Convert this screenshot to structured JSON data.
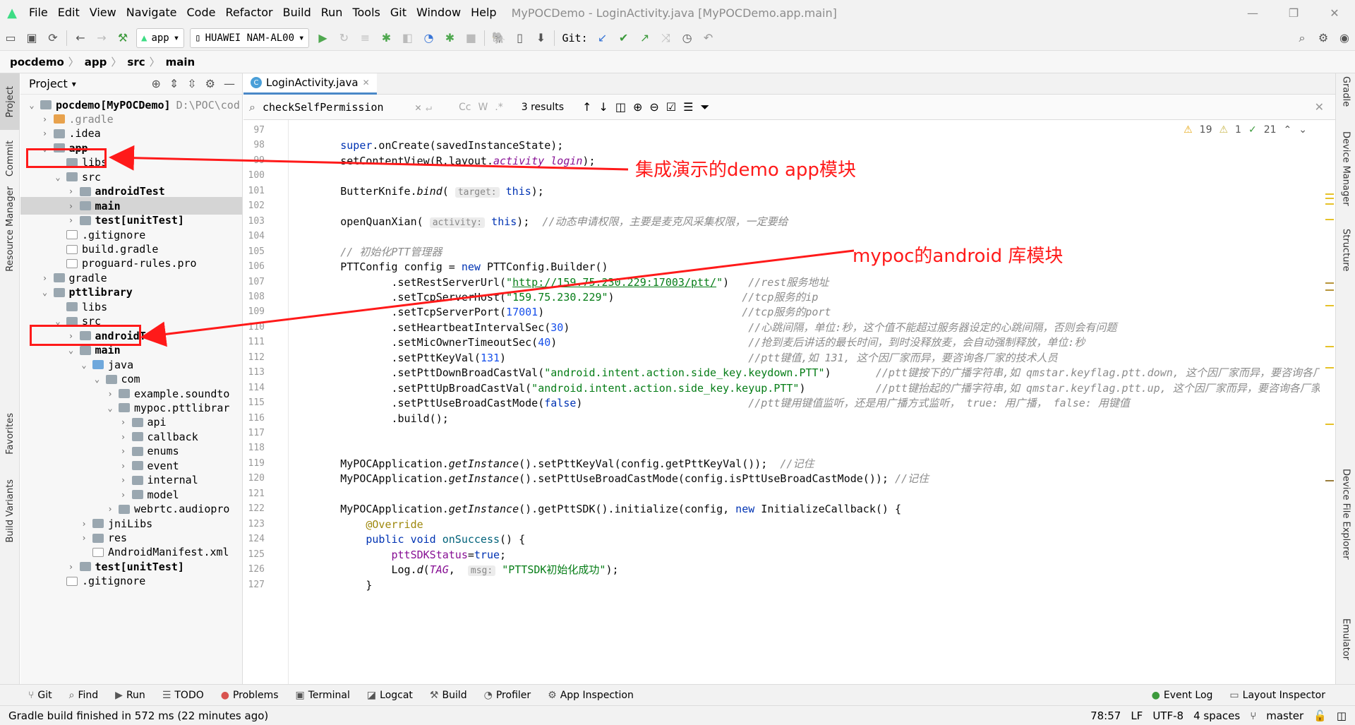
{
  "menubar": {
    "items": [
      "File",
      "Edit",
      "View",
      "Navigate",
      "Code",
      "Refactor",
      "Build",
      "Run",
      "Tools",
      "Git",
      "Window",
      "Help"
    ],
    "window_title": "MyPOCDemo - LoginActivity.java [MyPOCDemo.app.main]"
  },
  "toolbar": {
    "run_config": "app",
    "device": "HUAWEI NAM-AL00",
    "git_label": "Git:"
  },
  "breadcrumb": [
    "pocdemo",
    "app",
    "src",
    "main"
  ],
  "left_tabs": [
    "Project",
    "Commit",
    "Resource Manager",
    "Favorites",
    "Build Variants"
  ],
  "right_tabs": [
    "Gradle",
    "Device Manager",
    "Structure",
    "Device File Explorer",
    "Emulator"
  ],
  "project": {
    "title": "Project",
    "tree": [
      {
        "label": "pocdemo",
        "extra": " [MyPOCDemo]",
        "path": "D:\\POC\\cod",
        "indent": 0,
        "arrow": "down",
        "icon": "f-folder",
        "bold": true
      },
      {
        "label": ".gradle",
        "indent": 1,
        "arrow": "right",
        "icon": "f-orange",
        "ignored": true
      },
      {
        "label": ".idea",
        "indent": 1,
        "arrow": "right",
        "icon": "f-folder"
      },
      {
        "label": "app",
        "indent": 1,
        "arrow": "down",
        "icon": "f-folder",
        "bold": true
      },
      {
        "label": "libs",
        "indent": 2,
        "arrow": "",
        "icon": "f-folder"
      },
      {
        "label": "src",
        "indent": 2,
        "arrow": "down",
        "icon": "f-folder"
      },
      {
        "label": "androidTest",
        "indent": 3,
        "arrow": "right",
        "icon": "f-folder",
        "bold": true
      },
      {
        "label": "main",
        "indent": 3,
        "arrow": "right",
        "icon": "f-folder",
        "bold": true,
        "selected": true
      },
      {
        "label": "test",
        "extra": " [unitTest]",
        "indent": 3,
        "arrow": "right",
        "icon": "f-folder",
        "bold": true
      },
      {
        "label": ".gitignore",
        "indent": 2,
        "arrow": "",
        "icon": "f-file"
      },
      {
        "label": "build.gradle",
        "indent": 2,
        "arrow": "",
        "icon": "f-file"
      },
      {
        "label": "proguard-rules.pro",
        "indent": 2,
        "arrow": "",
        "icon": "f-file"
      },
      {
        "label": "gradle",
        "indent": 1,
        "arrow": "right",
        "icon": "f-folder"
      },
      {
        "label": "pttlibrary",
        "indent": 1,
        "arrow": "down",
        "icon": "f-folder",
        "bold": true
      },
      {
        "label": "libs",
        "indent": 2,
        "arrow": "",
        "icon": "f-folder"
      },
      {
        "label": "src",
        "indent": 2,
        "arrow": "down",
        "icon": "f-folder"
      },
      {
        "label": "androidTest",
        "indent": 3,
        "arrow": "right",
        "icon": "f-folder",
        "bold": true
      },
      {
        "label": "main",
        "indent": 3,
        "arrow": "down",
        "icon": "f-folder",
        "bold": true
      },
      {
        "label": "java",
        "indent": 4,
        "arrow": "down",
        "icon": "f-blue"
      },
      {
        "label": "com",
        "indent": 5,
        "arrow": "down",
        "icon": "f-folder"
      },
      {
        "label": "example.soundto",
        "indent": 6,
        "arrow": "right",
        "icon": "f-folder"
      },
      {
        "label": "mypoc.pttlibrar",
        "indent": 6,
        "arrow": "down",
        "icon": "f-folder"
      },
      {
        "label": "api",
        "indent": 7,
        "arrow": "right",
        "icon": "f-folder"
      },
      {
        "label": "callback",
        "indent": 7,
        "arrow": "right",
        "icon": "f-folder"
      },
      {
        "label": "enums",
        "indent": 7,
        "arrow": "right",
        "icon": "f-folder"
      },
      {
        "label": "event",
        "indent": 7,
        "arrow": "right",
        "icon": "f-folder"
      },
      {
        "label": "internal",
        "indent": 7,
        "arrow": "right",
        "icon": "f-folder"
      },
      {
        "label": "model",
        "indent": 7,
        "arrow": "right",
        "icon": "f-folder"
      },
      {
        "label": "webrtc.audiopro",
        "indent": 6,
        "arrow": "right",
        "icon": "f-folder"
      },
      {
        "label": "jniLibs",
        "indent": 4,
        "arrow": "right",
        "icon": "f-folder"
      },
      {
        "label": "res",
        "indent": 4,
        "arrow": "right",
        "icon": "f-folder"
      },
      {
        "label": "AndroidManifest.xml",
        "indent": 4,
        "arrow": "",
        "icon": "f-file"
      },
      {
        "label": "test",
        "extra": " [unitTest]",
        "indent": 3,
        "arrow": "right",
        "icon": "f-folder",
        "bold": true
      },
      {
        "label": ".gitignore",
        "indent": 2,
        "arrow": "",
        "icon": "f-file"
      }
    ]
  },
  "editor": {
    "tab": "LoginActivity.java",
    "search_query": "checkSelfPermission",
    "search_results": "3 results",
    "inspections": {
      "warnings": "19",
      "weak": "1",
      "ok": "21"
    }
  },
  "code": [
    {
      "n": "97",
      "html": ""
    },
    {
      "n": "98",
      "html": "        <span class='kw'>super</span>.onCreate(savedInstanceState);"
    },
    {
      "n": "99",
      "html": "        setContentView(R.layout.<span class='stat'>activity_login</span>);"
    },
    {
      "n": "100",
      "html": ""
    },
    {
      "n": "101",
      "html": "        ButterKnife.<span class='it'>bind</span>( <span class='hint'>target:</span> <span class='kw'>this</span>);"
    },
    {
      "n": "102",
      "html": ""
    },
    {
      "n": "103",
      "html": "        openQuanXian( <span class='hint'>activity:</span> <span class='kw'>this</span>);  <span class='cmt'>//动态申请权限，主要是麦克风采集权限，一定要给</span>"
    },
    {
      "n": "104",
      "html": ""
    },
    {
      "n": "105",
      "html": "        <span class='cmt'>// 初始化PTT管理器</span>"
    },
    {
      "n": "106",
      "html": "        PTTConfig config = <span class='kw'>new</span> PTTConfig.Builder()"
    },
    {
      "n": "107",
      "html": "                .setRestServerUrl(<span class='str'>\"</span><span class='link'>http://159.75.230.229:17003/ptt/</span><span class='str'>\"</span>)   <span class='cmt'>//rest服务地址</span>"
    },
    {
      "n": "108",
      "html": "                .setTcpServerHost(<span class='str'>\"159.75.230.229\"</span>)                    <span class='cmt'>//tcp服务的ip</span>"
    },
    {
      "n": "109",
      "html": "                .setTcpServerPort(<span class='num'>17001</span>)                               <span class='cmt'>//tcp服务的port</span>"
    },
    {
      "n": "110",
      "html": "                .setHeartbeatIntervalSec(<span class='num'>30</span>)                            <span class='cmt'>//心跳间隔，单位:秒，这个值不能超过服务器设定的心跳间隔，否则会有问题</span>"
    },
    {
      "n": "111",
      "html": "                .setMicOwnerTimeoutSec(<span class='num'>40</span>)                              <span class='cmt'>//抢到麦后讲话的最长时间，到时没释放麦，会自动强制释放，单位:秒</span>"
    },
    {
      "n": "112",
      "html": "                .setPttKeyVal(<span class='num'>131</span>)                                      <span class='cmt'>//ptt键值,如 131, 这个因厂家而异，要咨询各厂家的技术人员</span>"
    },
    {
      "n": "113",
      "html": "                .setPttDownBroadCastVal(<span class='str'>\"android.intent.action.side_key.keydown.PTT\"</span>)       <span class='cmt'>//ptt键按下的广播字符串,如 qmstar.keyflag.ptt.down, 这个因厂家而异，要咨询各厂</span>"
    },
    {
      "n": "114",
      "html": "                .setPttUpBroadCastVal(<span class='str'>\"android.intent.action.side_key.keyup.PTT\"</span>)           <span class='cmt'>//ptt键抬起的广播字符串,如 qmstar.keyflag.ptt.up, 这个因厂家而异，要咨询各厂家的</span>"
    },
    {
      "n": "115",
      "html": "                .setPttUseBroadCastMode(<span class='kw'>false</span>)                          <span class='cmt'>//ptt键用键值监听，还是用广播方式监听， true: 用广播， false: 用键值</span>"
    },
    {
      "n": "116",
      "html": "                .build();"
    },
    {
      "n": "117",
      "html": ""
    },
    {
      "n": "118",
      "html": ""
    },
    {
      "n": "119",
      "html": "        MyPOCApplication.<span class='it'>getInstance</span>().setPttKeyVal(config.getPttKeyVal());  <span class='cmt'>//记住</span>"
    },
    {
      "n": "120",
      "html": "        MyPOCApplication.<span class='it'>getInstance</span>().setPttUseBroadCastMode(config.isPttUseBroadCastMode()); <span class='cmt'>//记住</span>"
    },
    {
      "n": "121",
      "html": ""
    },
    {
      "n": "122",
      "html": "        MyPOCApplication.<span class='it'>getInstance</span>().getPttSDK().initialize(config, <span class='kw'>new</span> InitializeCallback() {"
    },
    {
      "n": "123",
      "html": "            <span class='anno'>@Override</span>"
    },
    {
      "n": "124",
      "html": "            <span class='kw'>public void</span> <span style='color:#00627a'>onSuccess</span>() {"
    },
    {
      "n": "125",
      "html": "                <span class='fld'>pttSDKStatus</span>=<span class='kw'>true</span>;"
    },
    {
      "n": "126",
      "html": "                Log.<span class='it'>d</span>(<span class='stat'>TAG</span>,  <span class='hint'>msg:</span> <span class='str'>\"PTTSDK初始化成功\"</span>);"
    },
    {
      "n": "127",
      "html": "            }"
    }
  ],
  "bottom_tools": [
    "Git",
    "Find",
    "Run",
    "TODO",
    "Problems",
    "Terminal",
    "Logcat",
    "Build",
    "Profiler",
    "App Inspection"
  ],
  "bottom_right_tools": [
    "Event Log",
    "Layout Inspector"
  ],
  "status": {
    "message": "Gradle build finished in 572 ms (22 minutes ago)",
    "position": "78:57",
    "line_sep": "LF",
    "encoding": "UTF-8",
    "indent": "4 spaces",
    "branch": "master"
  },
  "annotations": {
    "app_note": "集成演示的demo app模块",
    "lib_note": "mypoc的android 库模块"
  },
  "colors": {
    "annotation": "#ff1a1a",
    "accent": "#4a88c7"
  }
}
